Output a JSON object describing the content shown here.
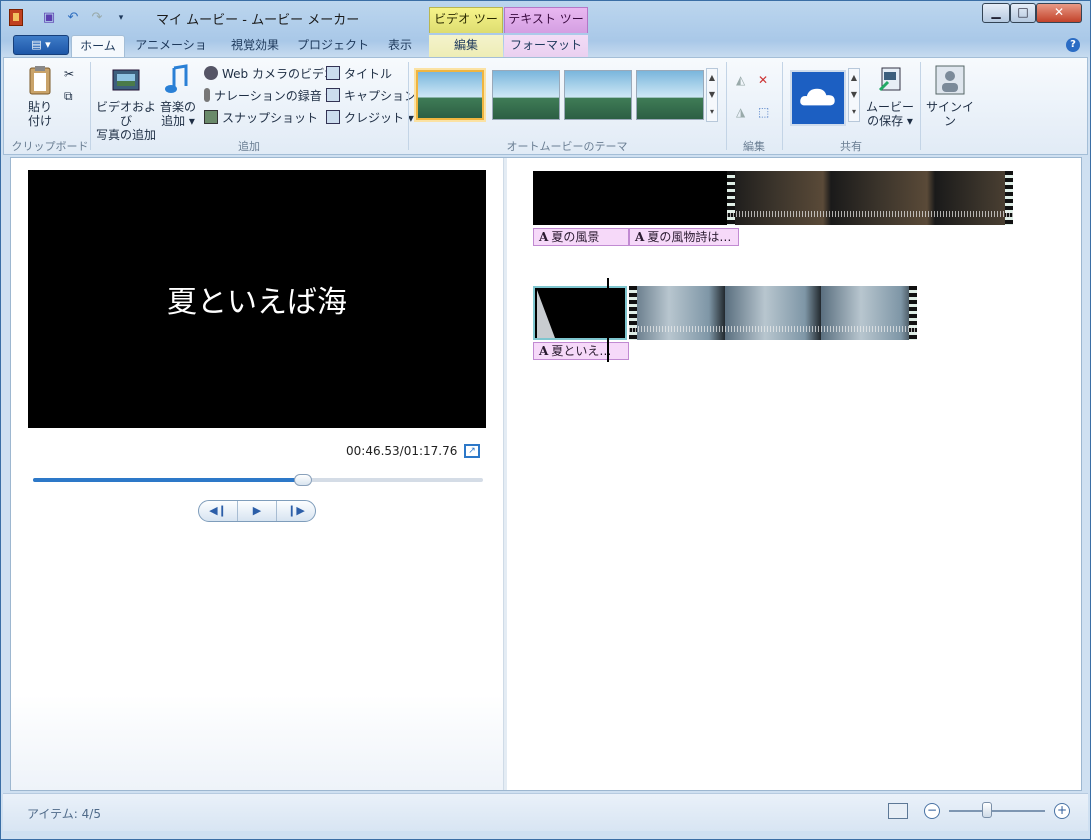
{
  "window": {
    "title": "マイ ムービー - ムービー メーカー"
  },
  "context_tabs": {
    "video_tools": "ビデオ ツール",
    "text_tools": "テキスト ツール"
  },
  "tabs": [
    {
      "label": "ホーム"
    },
    {
      "label": "アニメーション"
    },
    {
      "label": "視覚効果"
    },
    {
      "label": "プロジェクト"
    },
    {
      "label": "表示"
    },
    {
      "label": "編集"
    },
    {
      "label": "フォーマット"
    }
  ],
  "ribbon": {
    "clipboard": {
      "label": "クリップボード",
      "paste": "貼り付け"
    },
    "add": {
      "label": "追加",
      "add_videos_photos": "ビデオおよび\n写真の追加",
      "add_music": "音楽の\n追加 ▾",
      "webcam": "Web カメラのビデオ",
      "narration": "ナレーションの録音 ▾",
      "snapshot": "スナップショット",
      "title": "タイトル",
      "caption": "キャプション",
      "credits": "クレジット ▾"
    },
    "themes": {
      "label": "オートムービーのテーマ"
    },
    "editing": {
      "label": "編集"
    },
    "share": {
      "label": "共有",
      "save_movie": "ムービー\nの保存 ▾"
    },
    "signin": {
      "label": "サインイン"
    }
  },
  "preview": {
    "text": "夏といえば海",
    "time": "00:46.53/01:17.76",
    "progress": 0.6
  },
  "timeline": {
    "row1_captions": [
      "夏の風景",
      "夏の風物詩は…"
    ],
    "row2_captions": [
      "夏といえ…"
    ]
  },
  "status": {
    "items": "アイテム: 4/5",
    "zoom": 0.4
  },
  "colors": {
    "accent": "#2d78c8",
    "caption_bg": "#f6d9f9",
    "video_tools": "#f7f48a",
    "text_tools": "#e9b8f1"
  }
}
